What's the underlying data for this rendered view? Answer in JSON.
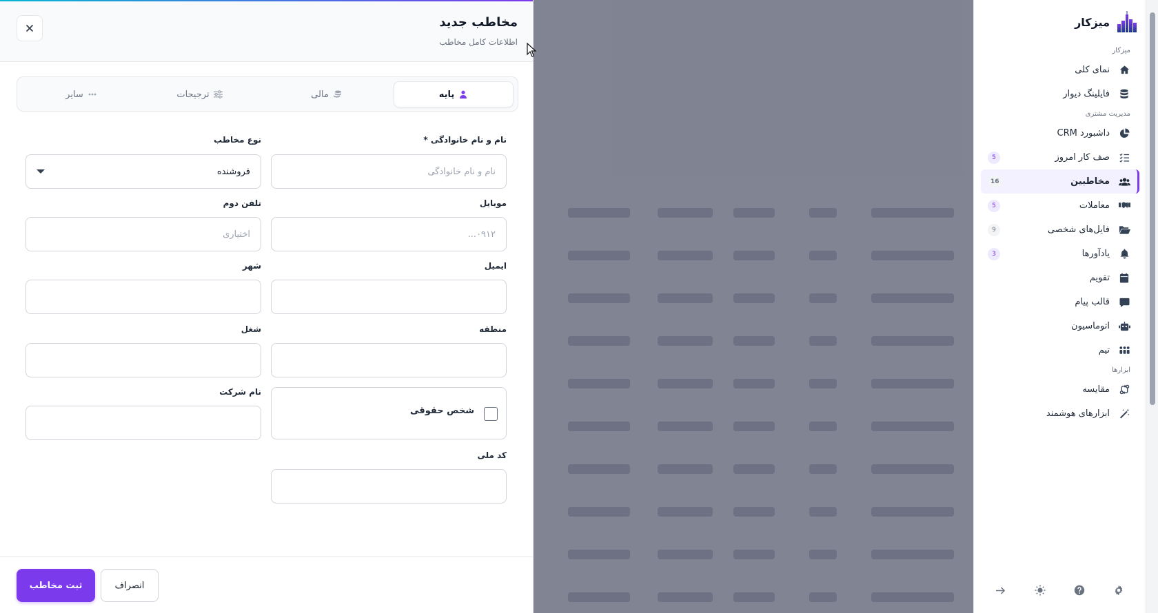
{
  "app": {
    "name": "میزکار",
    "accent_color": "#7c3aed"
  },
  "sidebar": {
    "section_workspace": "میزکار",
    "section_crm": "مدیریت مشتری",
    "section_tools": "ابزارها",
    "items": [
      {
        "label": "نمای کلی",
        "icon": "home-icon"
      },
      {
        "label": "فایلینگ دیوار",
        "icon": "database-icon"
      },
      {
        "label": "داشبورد CRM",
        "icon": "pie-chart-icon"
      },
      {
        "label": "صف کار امروز",
        "icon": "list-check-icon",
        "badge": "5"
      },
      {
        "label": "مخاطبین",
        "icon": "users-icon",
        "badge": "16",
        "active": true
      },
      {
        "label": "معاملات",
        "icon": "handshake-icon",
        "badge": "5"
      },
      {
        "label": "فایل‌های شخصی",
        "icon": "folder-icon",
        "badge": "9"
      },
      {
        "label": "یادآورها",
        "icon": "bell-icon",
        "badge": "3"
      },
      {
        "label": "تقویم",
        "icon": "calendar-icon"
      },
      {
        "label": "قالب پیام",
        "icon": "message-icon"
      },
      {
        "label": "اتوماسیون",
        "icon": "robot-icon"
      },
      {
        "label": "تیم",
        "icon": "team-icon"
      },
      {
        "label": "مقایسه",
        "icon": "compare-icon"
      },
      {
        "label": "ابزارهای هوشمند",
        "icon": "magic-wand-icon"
      }
    ],
    "footer_icons": [
      "gear-icon",
      "help-icon",
      "sun-icon",
      "arrow-right-icon"
    ]
  },
  "drawer": {
    "title": "مخاطب جدید",
    "subtitle": "اطلاعات کامل مخاطب",
    "tabs": [
      {
        "label": "پایه",
        "icon": "user-icon",
        "active": true
      },
      {
        "label": "مالی",
        "icon": "coins-icon"
      },
      {
        "label": "ترجیحات",
        "icon": "sliders-icon"
      },
      {
        "label": "سایر",
        "icon": "dots-icon"
      }
    ],
    "fields": {
      "full_name": {
        "label": "نام و نام خانوادگی *",
        "placeholder": "نام و نام خانوادگی",
        "value": ""
      },
      "contact_type": {
        "label": "نوع مخاطب",
        "value": "فروشنده"
      },
      "mobile": {
        "label": "موبایل",
        "placeholder": "۰۹۱۲...",
        "value": ""
      },
      "phone2": {
        "label": "تلفن دوم",
        "placeholder": "اختیاری",
        "value": ""
      },
      "email": {
        "label": "ایمیل",
        "value": ""
      },
      "city": {
        "label": "شهر",
        "value": ""
      },
      "region": {
        "label": "منطقه",
        "value": ""
      },
      "job": {
        "label": "شغل",
        "value": ""
      },
      "legal_person": {
        "label": "شخص حقوقی",
        "checked": false
      },
      "company": {
        "label": "نام شرکت",
        "value": ""
      },
      "national_code": {
        "label": "کد ملی",
        "value": ""
      }
    },
    "buttons": {
      "submit": "ثبت مخاطب",
      "cancel": "انصراف"
    }
  }
}
